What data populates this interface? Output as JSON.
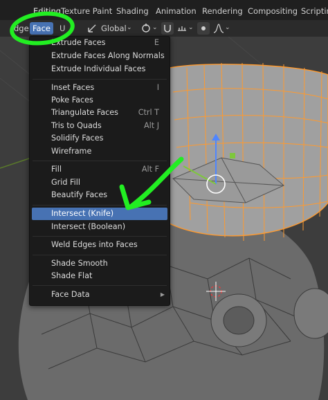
{
  "workspace_tabs": [
    "Editing",
    "Texture Paint",
    "Shading",
    "Animation",
    "Rendering",
    "Compositing",
    "Scripting"
  ],
  "header": {
    "edge_menu": "dge",
    "face_menu": "Face",
    "uv_menu": "U",
    "transform_orientation": "Global"
  },
  "menu": {
    "group1": [
      {
        "label": "Extrude Faces",
        "shortcut": "E"
      },
      {
        "label": "Extrude Faces Along Normals",
        "shortcut": ""
      },
      {
        "label": "Extrude Individual Faces",
        "shortcut": ""
      }
    ],
    "group2": [
      {
        "label": "Inset Faces",
        "shortcut": "I"
      },
      {
        "label": "Poke Faces",
        "shortcut": ""
      },
      {
        "label": "Triangulate Faces",
        "shortcut": "Ctrl T"
      },
      {
        "label": "Tris to Quads",
        "shortcut": "Alt J"
      },
      {
        "label": "Solidify Faces",
        "shortcut": ""
      },
      {
        "label": "Wireframe",
        "shortcut": ""
      }
    ],
    "group3": [
      {
        "label": "Fill",
        "shortcut": "Alt F"
      },
      {
        "label": "Grid Fill",
        "shortcut": ""
      },
      {
        "label": "Beautify Faces",
        "shortcut": ""
      }
    ],
    "group4": [
      {
        "label": "Intersect (Knife)",
        "shortcut": ""
      },
      {
        "label": "Intersect (Boolean)",
        "shortcut": ""
      }
    ],
    "group5": [
      {
        "label": "Weld Edges into Faces",
        "shortcut": ""
      }
    ],
    "group6": [
      {
        "label": "Shade Smooth",
        "shortcut": ""
      },
      {
        "label": "Shade Flat",
        "shortcut": ""
      }
    ],
    "group7": [
      {
        "label": "Face Data",
        "shortcut": ""
      }
    ]
  },
  "colors": {
    "accent": "#4772b3",
    "annotation": "#22ee22",
    "selection": "#ff9a2e"
  }
}
